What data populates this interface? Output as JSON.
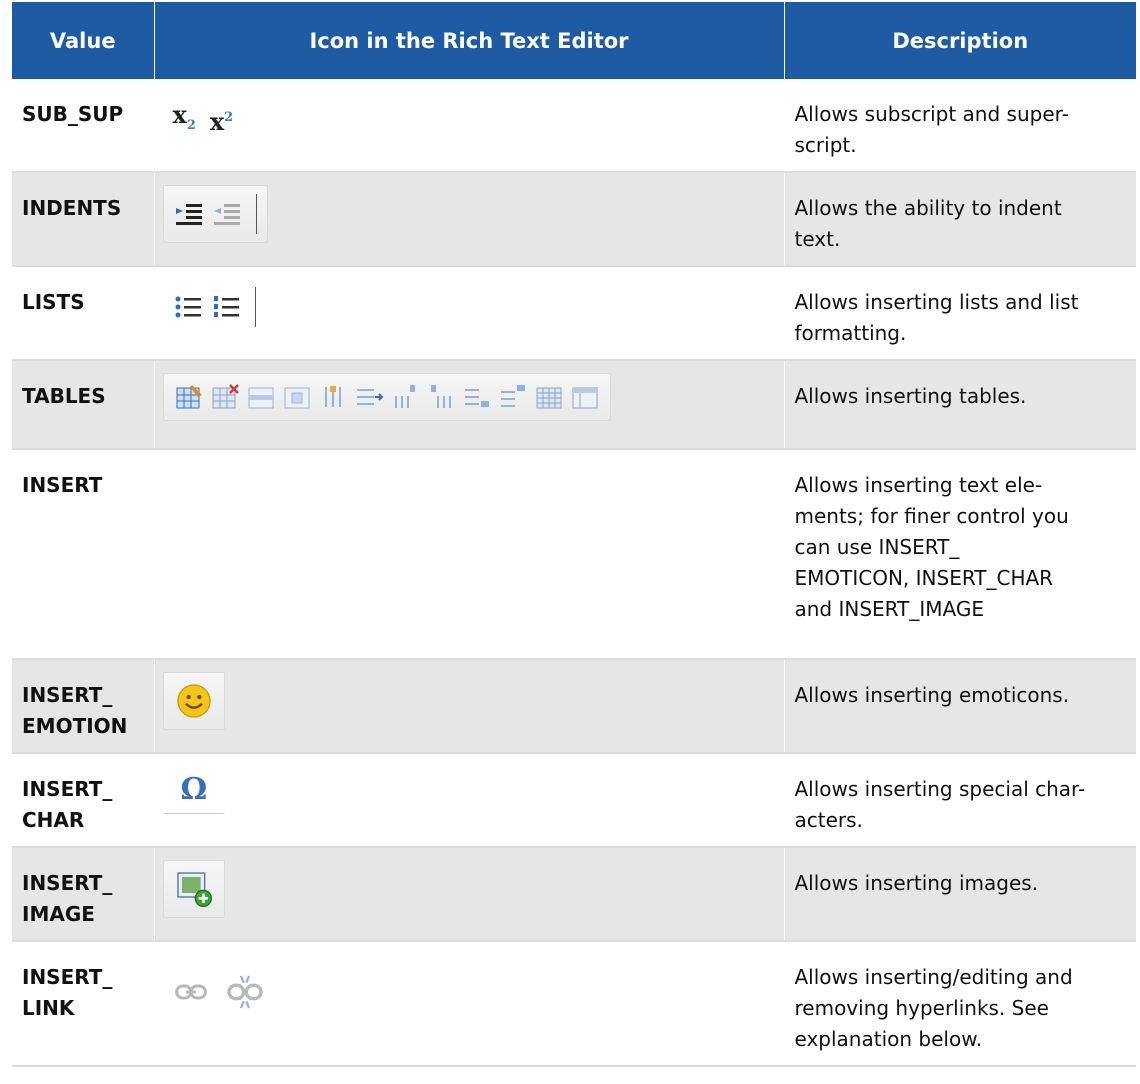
{
  "headers": [
    "Value",
    "Icon in the Rich Text Editor",
    "Description"
  ],
  "rows": [
    {
      "value": "SUB_SUP",
      "description": "Allows subscript and super-\nscript.",
      "icons": [
        "subscript-icon",
        "superscript-icon"
      ]
    },
    {
      "value": "INDENTS",
      "description": "Allows the ability to indent\ntext.",
      "icons": [
        "indent-icon",
        "outdent-icon"
      ]
    },
    {
      "value": "LISTS",
      "description": "Allows inserting lists and list\nformatting.",
      "icons": [
        "bulleted-list-icon",
        "numbered-list-icon"
      ]
    },
    {
      "value": "TABLES",
      "description": "Allows inserting tables.",
      "icons": [
        "insert-table-icon",
        "delete-table-icon",
        "table-row-icon",
        "merge-cells-icon",
        "insert-column-icon",
        "insert-row-after-icon",
        "insert-column-before-icon",
        "insert-column-after-icon",
        "insert-row-before-icon",
        "insert-row-above-icon",
        "table-grid-icon",
        "table-properties-icon"
      ]
    },
    {
      "value": "INSERT",
      "description": "Allows inserting text ele-\nments; for finer control you\ncan use INSERT_\nEMOTICON, INSERT_CHAR\nand INSERT_IMAGE",
      "icons": []
    },
    {
      "value": "INSERT_\nEMOTION",
      "description": "Allows inserting emoticons.",
      "icons": [
        "smiley-icon"
      ]
    },
    {
      "value": "INSERT_\nCHAR",
      "description": "Allows inserting special char-\nacters.",
      "icons": [
        "omega-icon"
      ]
    },
    {
      "value": "INSERT_\nIMAGE",
      "description": "Allows inserting images.",
      "icons": [
        "insert-image-icon"
      ]
    },
    {
      "value": "INSERT_\nLINK",
      "description": "Allows inserting/editing and\nremoving hyperlinks. See\nexplanation below.",
      "icons": [
        "link-icon",
        "unlink-icon"
      ]
    }
  ],
  "glyphs": {
    "x": "x",
    "sub": "2",
    "sup": "2",
    "omega": "Ω"
  }
}
